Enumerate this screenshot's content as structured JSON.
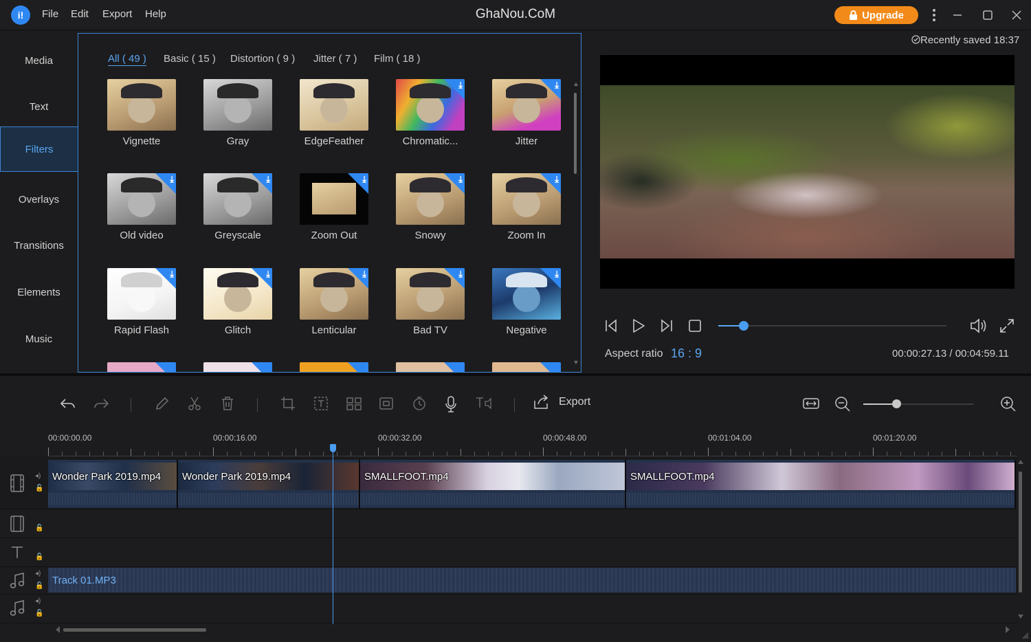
{
  "app": {
    "title": "GhaNou.CoM",
    "logo_glyph": "i!",
    "menu": [
      "File",
      "Edit",
      "Export",
      "Help"
    ],
    "upgrade_label": "Upgrade",
    "upgrade_icon": "lock-icon",
    "window_controls": [
      "more-icon",
      "minimize-icon",
      "maximize-icon",
      "close-icon"
    ]
  },
  "sidebar": {
    "items": [
      {
        "label": "Media",
        "active": false
      },
      {
        "label": "Text",
        "active": false
      },
      {
        "label": "Filters",
        "active": true
      },
      {
        "label": "Overlays",
        "active": false
      },
      {
        "label": "Transitions",
        "active": false
      },
      {
        "label": "Elements",
        "active": false
      },
      {
        "label": "Music",
        "active": false
      }
    ]
  },
  "filters": {
    "categories": [
      {
        "label": "All ( 49 )",
        "active": true
      },
      {
        "label": "Basic ( 15 )",
        "active": false
      },
      {
        "label": "Distortion ( 9 )",
        "active": false
      },
      {
        "label": "Jitter ( 7 )",
        "active": false
      },
      {
        "label": "Film ( 18 )",
        "active": false
      }
    ],
    "items": [
      {
        "label": "Vignette",
        "download": false,
        "tint": "warm"
      },
      {
        "label": "Gray",
        "download": false,
        "tint": "gray"
      },
      {
        "label": "EdgeFeather",
        "download": false,
        "tint": "soft"
      },
      {
        "label": "Chromatic...",
        "download": true,
        "tint": "rainbow"
      },
      {
        "label": "Jitter",
        "download": true,
        "tint": "jitter"
      },
      {
        "label": "Old video",
        "download": true,
        "tint": "gray"
      },
      {
        "label": "Greyscale",
        "download": true,
        "tint": "gray"
      },
      {
        "label": "Zoom Out",
        "download": true,
        "tint": "dark"
      },
      {
        "label": "Snowy",
        "download": true,
        "tint": "warm"
      },
      {
        "label": "Zoom In",
        "download": true,
        "tint": "warm"
      },
      {
        "label": "Rapid Flash",
        "download": true,
        "tint": "white"
      },
      {
        "label": "Glitch",
        "download": true,
        "tint": "bright"
      },
      {
        "label": "Lenticular",
        "download": true,
        "tint": "warm"
      },
      {
        "label": "Bad TV",
        "download": true,
        "tint": "warm"
      },
      {
        "label": "Negative",
        "download": true,
        "tint": "negative"
      }
    ],
    "partial_row_tints": [
      "#e6a9c6",
      "#f0e0e8",
      "#f0a020",
      "#e0c0a0",
      "#e0b890"
    ]
  },
  "preview": {
    "saved_status": "Recently saved 18:37",
    "aspect_label": "Aspect ratio",
    "aspect_value": "16 : 9",
    "timecode": "00:00:27.13 / 00:04:59.11",
    "progress_fraction": 0.11,
    "controls": [
      "prev-frame-icon",
      "play-icon",
      "next-frame-icon",
      "stop-icon",
      "volume-icon",
      "fullscreen-icon"
    ]
  },
  "toolbar": {
    "export_label": "Export",
    "zoom_fraction": 0.3
  },
  "timeline": {
    "ruler_labels": [
      "00:00:00.00",
      "00:00:16.00",
      "00:00:32.00",
      "00:00:48.00",
      "00:01:04.00",
      "00:01:20.00"
    ],
    "video_clips": [
      {
        "name": "Wonder Park 2019.mp4"
      },
      {
        "name": "Wonder Park 2019.mp4"
      },
      {
        "name": "SMALLFOOT.mp4"
      },
      {
        "name": "SMALLFOOT.mp4"
      }
    ],
    "audio_clip": "Track 01.MP3"
  }
}
